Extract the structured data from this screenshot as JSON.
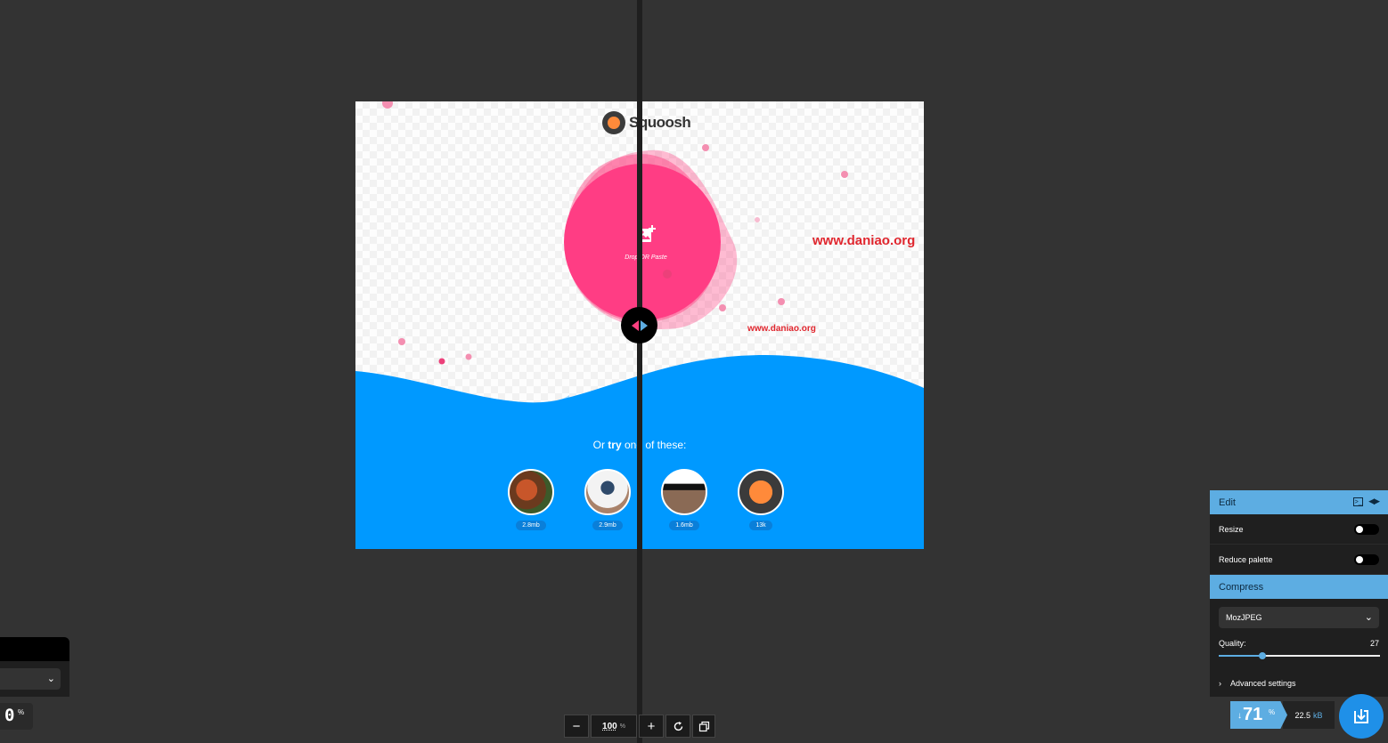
{
  "preview": {
    "logo_text": "Squoosh",
    "drop_text": "Drop OR Paste",
    "watermark_large": "www.daniao.org",
    "watermark_small": "www.daniao.org",
    "try_prefix": "Or ",
    "try_bold": "try",
    "try_suffix": " one of these:",
    "demos": [
      {
        "name": "red-panda",
        "size": "2.8mb"
      },
      {
        "name": "artwork",
        "size": "2.9mb"
      },
      {
        "name": "device-screen",
        "size": "1.6mb"
      },
      {
        "name": "squoosh-logo",
        "size": "13k"
      }
    ]
  },
  "left_panel": {
    "percent": "0",
    "percent_unit": "%"
  },
  "zoom": {
    "minus_label": "−",
    "value": "100",
    "unit": "%",
    "plus_label": "+"
  },
  "edit_panel": {
    "title": "Edit",
    "options": [
      {
        "label": "Resize",
        "enabled": false
      },
      {
        "label": "Reduce palette",
        "enabled": false
      }
    ]
  },
  "compress_panel": {
    "title": "Compress",
    "encoder": "MozJPEG",
    "quality_label": "Quality:",
    "quality_value": "27",
    "quality_fraction": 0.27,
    "advanced_label": "Advanced settings"
  },
  "result": {
    "arrow": "↓",
    "percent": "71",
    "percent_unit": "%",
    "size": "22.5",
    "size_unit": "kB"
  },
  "colors": {
    "accent": "#5dade2",
    "brand_pink": "#ff4081",
    "wave_blue": "#0099ff",
    "background": "#333333"
  }
}
